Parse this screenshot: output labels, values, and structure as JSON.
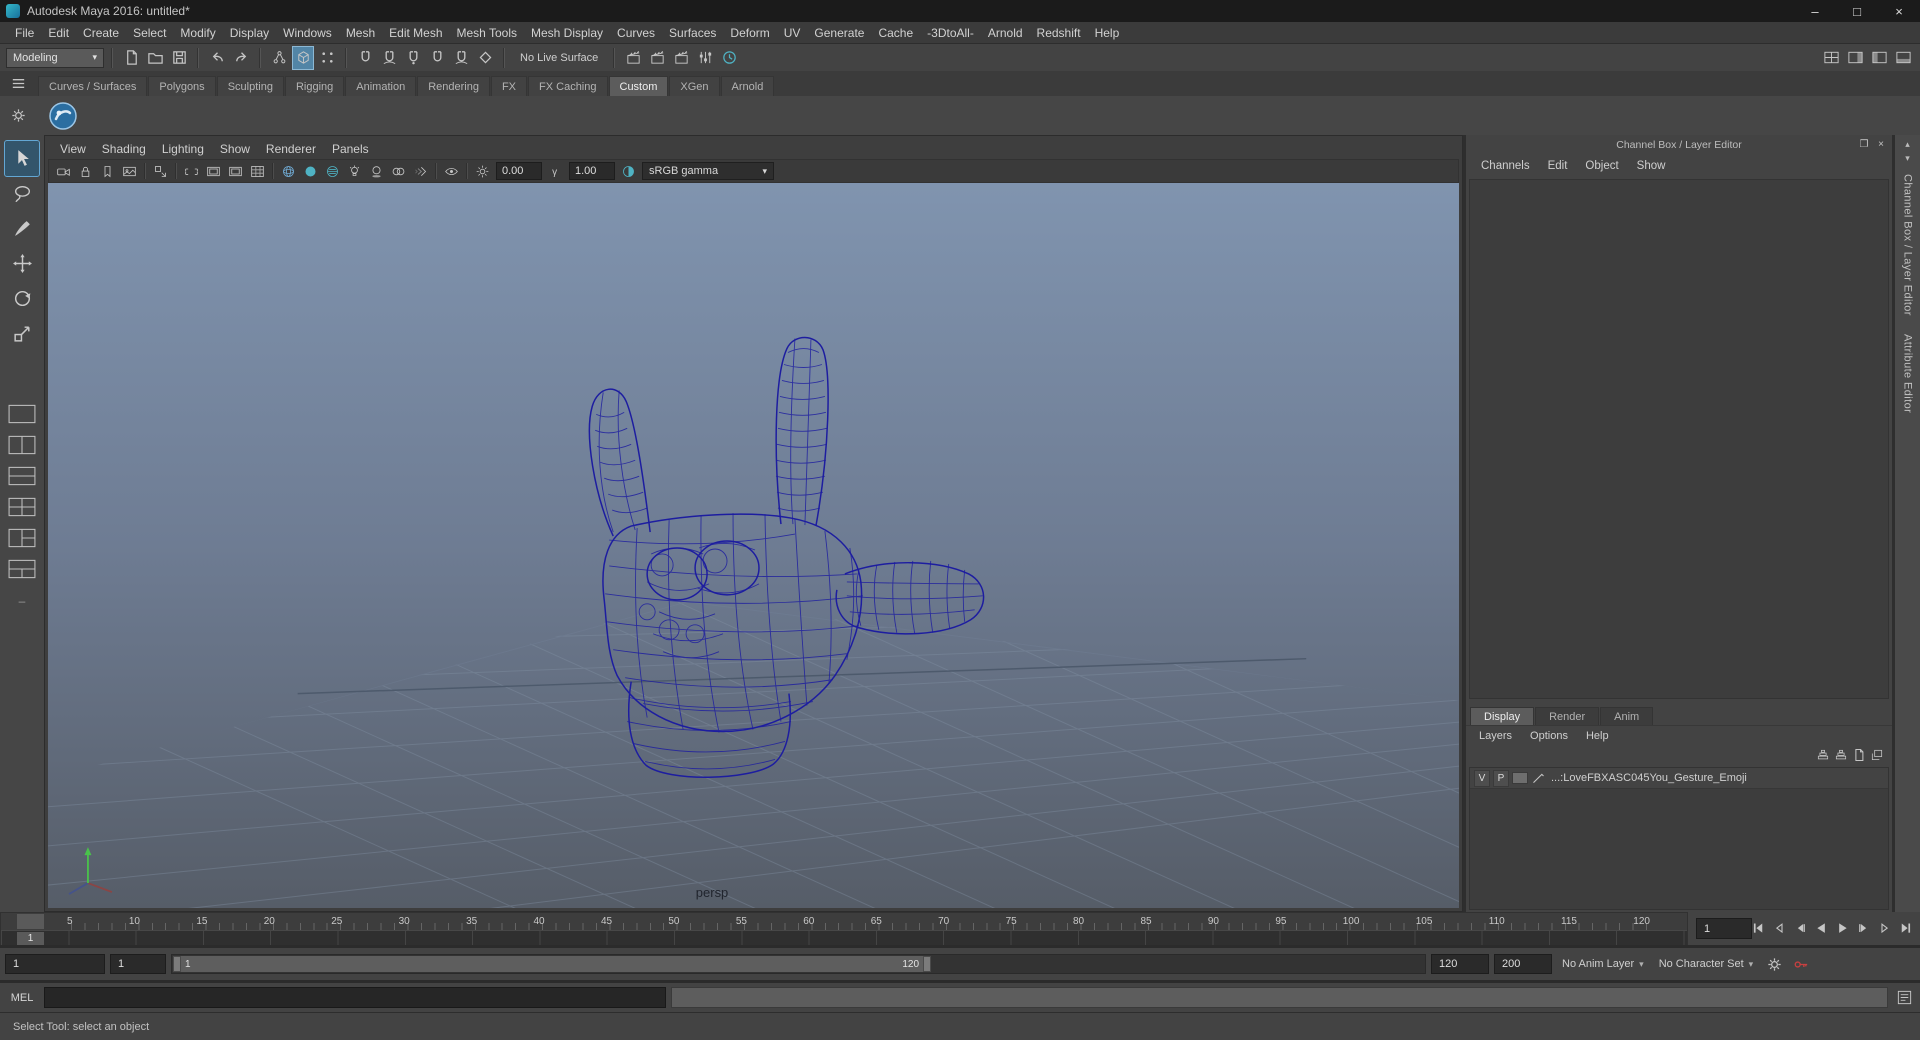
{
  "window": {
    "title": "Autodesk Maya 2016: untitled*",
    "minimize": "–",
    "maximize": "□",
    "close": "×"
  },
  "icons": {
    "dropdown": "▾",
    "scroll_up": "▴",
    "scroll_down": "▾",
    "float": "❐",
    "close": "×"
  },
  "menu_bar": {
    "items": [
      "File",
      "Edit",
      "Create",
      "Select",
      "Modify",
      "Display",
      "Windows",
      "Mesh",
      "Edit Mesh",
      "Mesh Tools",
      "Mesh Display",
      "Curves",
      "Surfaces",
      "Deform",
      "UV",
      "Generate",
      "Cache",
      "-3DtoAll-",
      "Arnold",
      "Redshift",
      "Help"
    ]
  },
  "status_line": {
    "mode": "Modeling",
    "no_live_surface": "No Live Surface"
  },
  "shelf": {
    "tabs": [
      "Curves / Surfaces",
      "Polygons",
      "Sculpting",
      "Rigging",
      "Animation",
      "Rendering",
      "FX",
      "FX Caching",
      "Custom",
      "XGen",
      "Arnold"
    ],
    "active_tab": "Custom"
  },
  "viewport": {
    "menus": [
      "View",
      "Shading",
      "Lighting",
      "Show",
      "Renderer",
      "Panels"
    ],
    "exposure": "0.00",
    "gamma": "1.00",
    "color_transform": "sRGB gamma",
    "camera_label": "persp"
  },
  "channel_box": {
    "title": "Channel Box / Layer Editor",
    "menus": [
      "Channels",
      "Edit",
      "Object",
      "Show"
    ],
    "layer_editor": {
      "tabs": [
        "Display",
        "Render",
        "Anim"
      ],
      "active_tab": "Display",
      "menus": [
        "Layers",
        "Options",
        "Help"
      ],
      "layer": {
        "visibility": "V",
        "playback": "P",
        "name": "...:LoveFBXASC045You_Gesture_Emoji"
      }
    }
  },
  "right_strip": {
    "labels": [
      "Channel Box / Layer Editor",
      "Attribute Editor"
    ]
  },
  "time_slider": {
    "ticks": [
      "5",
      "10",
      "15",
      "20",
      "25",
      "30",
      "35",
      "40",
      "45",
      "50",
      "55",
      "60",
      "65",
      "70",
      "75",
      "80",
      "85",
      "90",
      "95",
      "100",
      "105",
      "110",
      "115",
      "120"
    ],
    "playhead_frame": "1",
    "current_frame": "1"
  },
  "range_slider": {
    "animation_start": "1",
    "playback_start": "1",
    "bar_start_label": "1",
    "bar_end_label": "120",
    "playback_end": "120",
    "animation_end": "200",
    "anim_layer": "No Anim Layer",
    "character_set": "No Character Set"
  },
  "command_line": {
    "label": "MEL"
  },
  "help_line": {
    "message": "Select Tool: select an object"
  },
  "colors": {
    "accent_blue": "#5285a6",
    "wireframe_navy": "#1d1da0",
    "autokey_red": "#c84040",
    "viewport_top": "#8094af",
    "viewport_bottom": "#565d68"
  }
}
